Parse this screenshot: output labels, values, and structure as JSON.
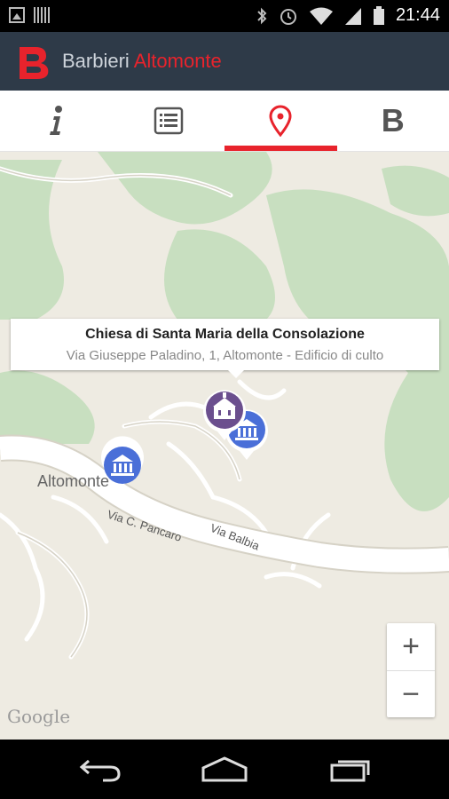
{
  "status_bar": {
    "time": "21:44",
    "icons": [
      "image-icon",
      "barcode-icon",
      "bluetooth-icon",
      "alarm-icon",
      "wifi-icon",
      "signal-icon",
      "battery-icon"
    ]
  },
  "app_bar": {
    "title_part1": "Barbieri",
    "title_part2": "Altomonte",
    "brand_color": "#e8232c",
    "bar_color": "#2e3a48"
  },
  "tabs": [
    {
      "name": "info",
      "icon": "info-icon",
      "active": false
    },
    {
      "name": "list",
      "icon": "list-icon",
      "active": false
    },
    {
      "name": "map",
      "icon": "map-pin-icon",
      "active": true
    },
    {
      "name": "b",
      "icon": "b-letter-icon",
      "active": false
    }
  ],
  "tab_b_label": "B",
  "map": {
    "info_window": {
      "title": "Chiesa di Santa Maria della Consolazione",
      "subtitle": "Via Giuseppe Paladino, 1, Altomonte - Edificio di culto"
    },
    "labels": {
      "town": "Altomonte",
      "road1": "Via C. Pancaro",
      "road2": "Via Balbia"
    },
    "attribution": "Google",
    "zoom_in": "+",
    "zoom_out": "−"
  }
}
